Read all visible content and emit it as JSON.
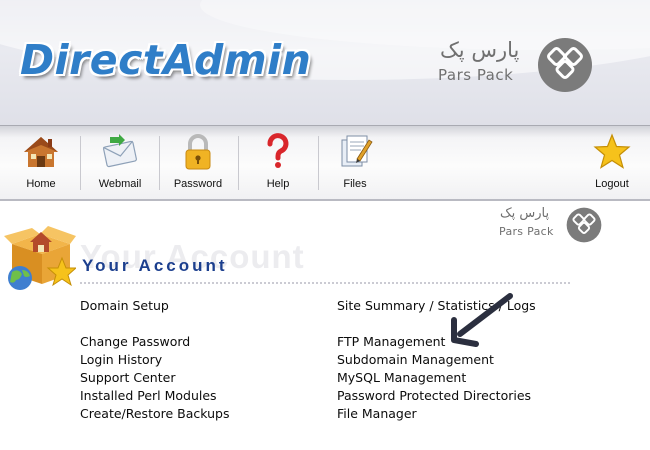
{
  "app": {
    "logo_text": "DirectAdmin"
  },
  "watermark": {
    "brand_fa": "پارس پک",
    "brand_en": "Pars Pack"
  },
  "toolbar": {
    "items": [
      {
        "label": "Home",
        "icon": "house-icon"
      },
      {
        "label": "Webmail",
        "icon": "envelope-icon"
      },
      {
        "label": "Password",
        "icon": "padlock-icon"
      },
      {
        "label": "Help",
        "icon": "question-mark-icon"
      },
      {
        "label": "Files",
        "icon": "documents-icon"
      },
      {
        "label": "Logout",
        "icon": "star-icon"
      }
    ]
  },
  "section": {
    "ghost_title": "Your Account",
    "title": "Your Account",
    "icon": "account-box-icon"
  },
  "links": {
    "left": [
      "Domain Setup",
      "Change Password",
      "Login History",
      "Support Center",
      "Installed Perl Modules",
      "Create/Restore Backups"
    ],
    "right": [
      "Site Summary / Statistics / Logs",
      "FTP Management",
      "Subdomain Management",
      "MySQL Management",
      "Password Protected Directories",
      "File Manager"
    ]
  },
  "annotation": {
    "icon": "arrow-icon",
    "color": "#2b2f3f"
  },
  "colors": {
    "logo_blue": "#2f7ec8",
    "section_title": "#1c3f8e"
  }
}
